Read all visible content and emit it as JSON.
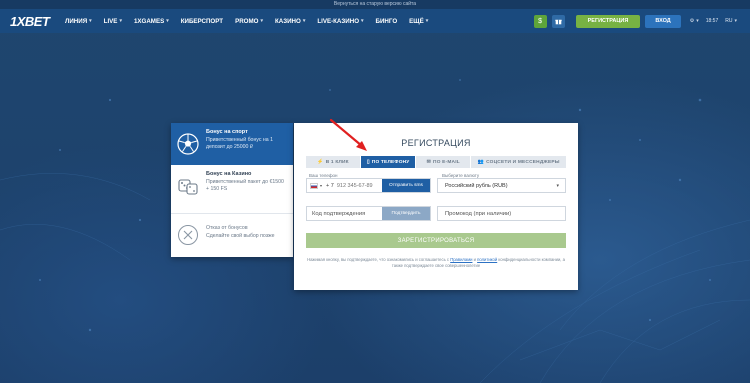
{
  "notice": "Вернуться на старую версию сайта",
  "header": {
    "logo": "1XBET",
    "nav": [
      {
        "label": "ЛИНИЯ",
        "dropdown": true
      },
      {
        "label": "LIVE",
        "dropdown": true
      },
      {
        "label": "1XGAMES",
        "dropdown": true
      },
      {
        "label": "КИБЕРСПОРТ",
        "dropdown": false
      },
      {
        "label": "PROMO",
        "dropdown": true
      },
      {
        "label": "КАЗИНО",
        "dropdown": true
      },
      {
        "label": "LIVE-КАЗИНО",
        "dropdown": true
      },
      {
        "label": "БИНГО",
        "dropdown": false
      },
      {
        "label": "ЕЩЁ",
        "dropdown": true
      }
    ],
    "register_label": "РЕГИСТРАЦИЯ",
    "login_label": "ВХОД",
    "time": "18:57",
    "language": "RU",
    "icons": [
      "dollar-icon",
      "gift-icon",
      "gear-icon"
    ]
  },
  "bonus": {
    "sport": {
      "title": "Бонус на спорт",
      "desc": "Приветственный бонус на 1 депозит до 25000 ₽"
    },
    "casino": {
      "title": "Бонус на Казино",
      "desc": "Приветственный пакет до €1500 + 150 FS"
    },
    "decline": {
      "title": "Отказ от бонусов",
      "desc": "Сделайте свой выбор позже"
    }
  },
  "registration": {
    "title": "РЕГИСТРАЦИЯ",
    "tabs": [
      {
        "label": "В 1 КЛИК",
        "icon": "lightning-icon",
        "active": false
      },
      {
        "label": "ПО ТЕЛЕФОНУ",
        "icon": "phone-icon",
        "active": true
      },
      {
        "label": "ПО E-MAIL",
        "icon": "mail-icon",
        "active": false
      },
      {
        "label": "СОЦСЕТИ И МЕССЕНДЖЕРЫ",
        "icon": "people-icon",
        "active": false
      }
    ],
    "phone_label": "Ваш телефон",
    "phone_code": "+ 7",
    "phone_placeholder": "912 345-67-89",
    "send_sms_label": "Отправить sms",
    "currency_label": "Выберите валюту",
    "currency_value": "Российский рубль (RUB)",
    "code_placeholder": "Код подтверждения",
    "confirm_label": "Подтвердить",
    "promo_placeholder": "Промокод (при наличии)",
    "submit_label": "ЗАРЕГИСТРИРОВАТЬСЯ",
    "terms_prefix": "Нажимая кнопку, вы подтверждаете, что ознакомились и соглашаетесь с ",
    "terms_link1": "Правилами",
    "terms_and": " и ",
    "terms_link2": "политикой",
    "terms_suffix": " конфиденциальности компании, а также подтверждаете свое совершеннолетие"
  },
  "colors": {
    "background": "#1d4270",
    "header": "#1a4a7e",
    "accent_blue": "#1f5fa4",
    "register_green": "#77b243",
    "submit_green": "#a9c98e",
    "arrow_red": "#e02020"
  }
}
